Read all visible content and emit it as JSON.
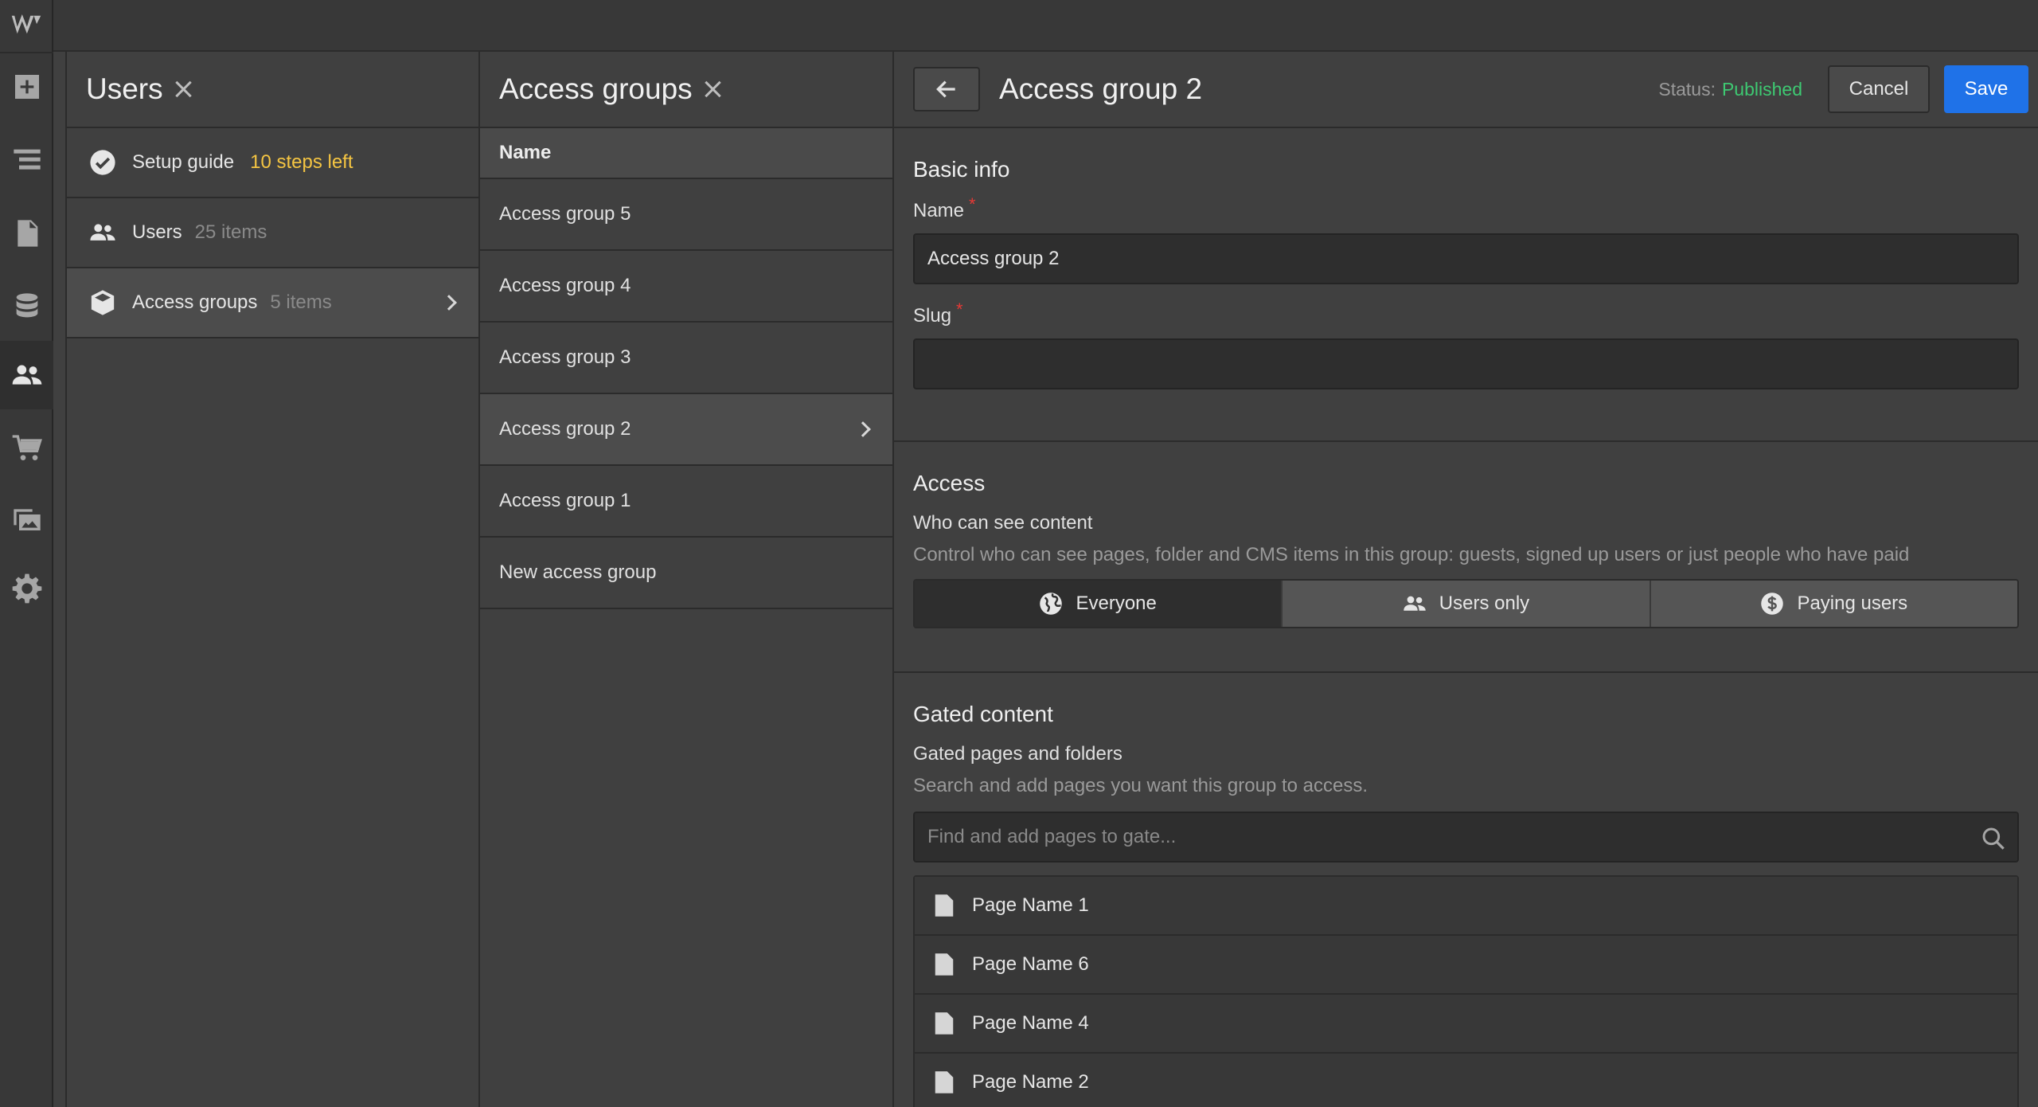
{
  "rail": {
    "logo": "W",
    "items": [
      "add-icon",
      "navigator-icon",
      "pages-icon",
      "cms-icon",
      "users-icon",
      "ecommerce-icon",
      "assets-icon",
      "settings-icon"
    ]
  },
  "users_panel": {
    "title": "Users",
    "items": [
      {
        "label": "Setup guide",
        "extra": "10 steps left",
        "icon": "check-circle-icon"
      },
      {
        "label": "Users",
        "extra": "25 items",
        "icon": "users-icon"
      },
      {
        "label": "Access groups",
        "extra": "5 items",
        "icon": "cube-icon"
      }
    ]
  },
  "groups_panel": {
    "title": "Access groups",
    "column": "Name",
    "rows": [
      "Access group 5",
      "Access group 4",
      "Access group 3",
      "Access group 2",
      "Access group 1",
      "New access group"
    ]
  },
  "detail": {
    "title": "Access group 2",
    "status_label": "Status:",
    "status_value": "Published",
    "cancel": "Cancel",
    "save": "Save",
    "basic_info": {
      "title": "Basic info",
      "name_label": "Name",
      "name_value": "Access group 2",
      "slug_label": "Slug",
      "slug_value": "",
      "required_mark": "*"
    },
    "access": {
      "title": "Access",
      "who_label": "Who can see content",
      "who_help": "Control who can see pages, folder and CMS items in this group: guests, signed up users or just people who have paid",
      "options": [
        "Everyone",
        "Users only",
        "Paying users"
      ],
      "selected": "Everyone"
    },
    "gated": {
      "title": "Gated content",
      "label": "Gated pages and folders",
      "help": "Search and add pages you want this group to access.",
      "search_placeholder": "Find and add pages to gate...",
      "pages": [
        "Page Name 1",
        "Page Name 6",
        "Page Name 4",
        "Page Name 2"
      ]
    }
  },
  "colors": {
    "accent": "#1f72e8",
    "published": "#3ec972",
    "warning": "#f5c542",
    "required": "#e53935"
  }
}
